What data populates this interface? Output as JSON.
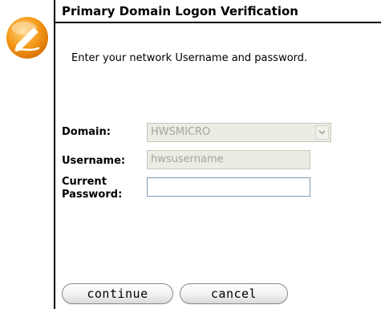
{
  "title": "Primary Domain Logon Verification",
  "instructions": "Enter your network Username and password.",
  "form": {
    "domain_label": "Domain:",
    "domain_value": "HWSMICRO",
    "username_label": "Username:",
    "username_value": "hwsusername",
    "password_label_line1": "Current",
    "password_label_line2": "Password:",
    "password_value": ""
  },
  "buttons": {
    "continue": "continue",
    "cancel": "cancel"
  },
  "colors": {
    "logo_orange": "#f59a1b",
    "field_border": "#7f9db9",
    "disabled_bg": "#ecebe4"
  },
  "icons": {
    "logo": "pen-signature-icon",
    "dropdown": "chevron-down-icon"
  }
}
